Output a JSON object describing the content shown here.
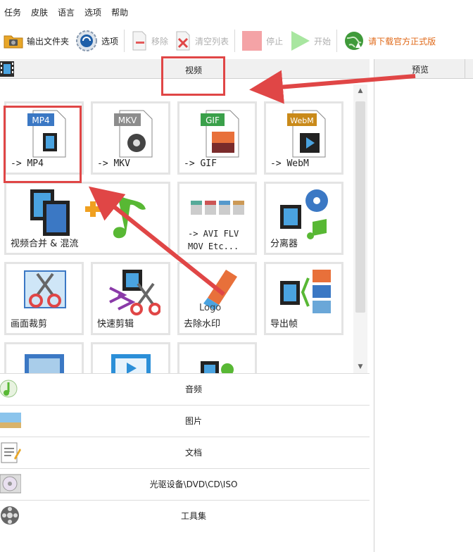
{
  "menu": [
    "任务",
    "皮肤",
    "语言",
    "选项",
    "帮助"
  ],
  "toolbar": {
    "output_folder": "输出文件夹",
    "options": "选项",
    "remove": "移除",
    "clear_list": "清空列表",
    "stop": "停止",
    "start": "开始",
    "download": "请下载官方正式版"
  },
  "header": {
    "category": "视频",
    "preview": "预览"
  },
  "tiles": {
    "mp4": {
      "badge": "MP4",
      "label": "-> MP4"
    },
    "mkv": {
      "badge": "MKV",
      "label": "-> MKV"
    },
    "gif": {
      "badge": "GIF",
      "label": "-> GIF"
    },
    "webm": {
      "badge": "WebM",
      "label": "-> WebM"
    },
    "merge": {
      "label": "视频合并 & 混流"
    },
    "avi": {
      "line1": "-> AVI FLV",
      "line2": "MOV Etc..."
    },
    "splitter": {
      "label": "分离器"
    },
    "crop": {
      "label": "画面裁剪"
    },
    "quickcut": {
      "label": "快速剪辑"
    },
    "watermark": {
      "label": "去除水印",
      "logo_text": "Logo"
    },
    "frames": {
      "label": "导出帧"
    }
  },
  "categories": {
    "audio": "音频",
    "picture": "图片",
    "document": "文档",
    "disc": "光驱设备\\DVD\\CD\\ISO",
    "tools": "工具集"
  },
  "colors": {
    "annotation": "#e04646",
    "accent": "#2b79c2"
  }
}
